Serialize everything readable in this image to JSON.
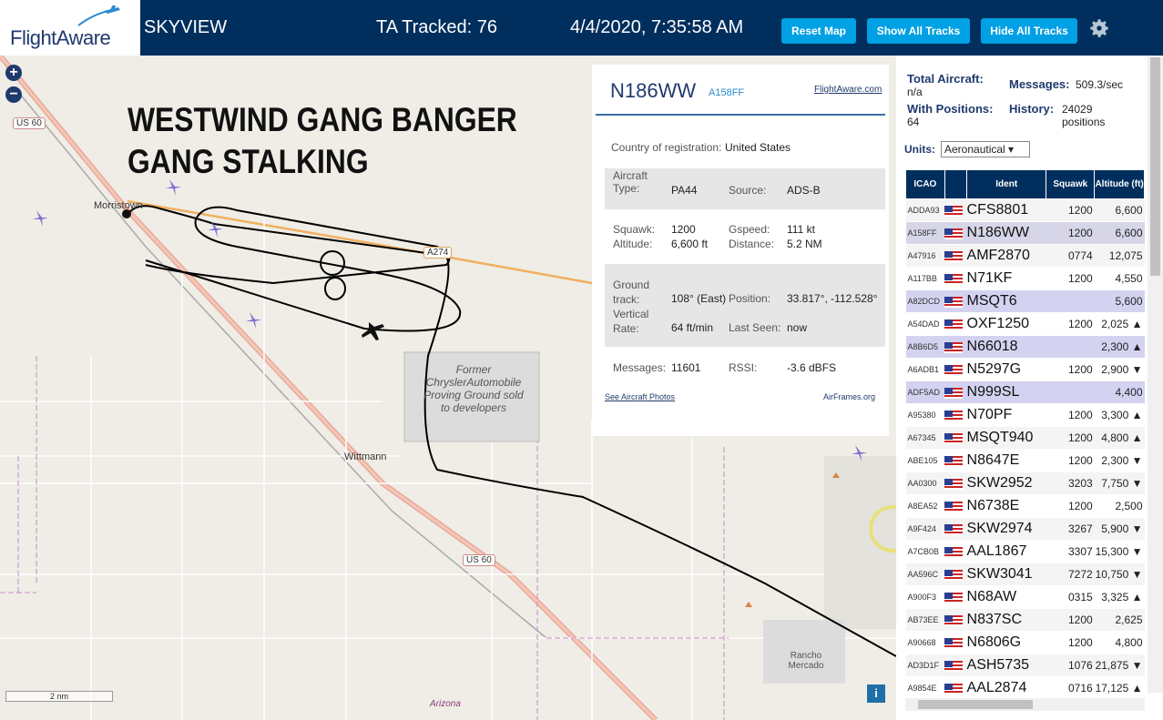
{
  "header": {
    "logo": "FlightAware",
    "app_title": "SKYVIEW",
    "tracked": "TA Tracked: 76",
    "datetime": "4/4/2020, 7:35:58 AM",
    "buttons": {
      "reset": "Reset Map",
      "show": "Show All Tracks",
      "hide": "Hide All Tracks"
    }
  },
  "map": {
    "overlay_line1": "WESTWIND GANG BANGER",
    "overlay_line2": "GANG STALKING",
    "labels": {
      "morristown": "Morristown",
      "wittmann": "Wittmann",
      "proving_ground": "Former ChryslerAutomobile Proving Ground sold to developers",
      "rancho": "Rancho Mercado",
      "arizona": "Arizona",
      "us60_top": "US 60",
      "us60_mid": "US 60",
      "a274": "A274"
    },
    "scale": "2 nm",
    "info": "i",
    "zoom_in": "+",
    "zoom_out": "−"
  },
  "detail": {
    "ident": "N186WW",
    "icao": "A158FF",
    "fa_link": "FlightAware.com",
    "country_label": "Country of registration:",
    "country": "United States",
    "aircraft_type_label": "Aircraft Type:",
    "aircraft_type": "PA44",
    "source_label": "Source:",
    "source": "ADS-B",
    "squawk_label": "Squawk:",
    "squawk": "1200",
    "gspeed_label": "Gspeed:",
    "gspeed": "111 kt",
    "altitude_label": "Altitude:",
    "altitude": "6,600 ft",
    "distance_label": "Distance:",
    "distance": "5.2 NM",
    "ground_track_label": "Ground track:",
    "ground_track": "108° (East)",
    "position_label": "Position:",
    "position": "33.817°, -112.528°",
    "vrate_label": "Vertical Rate:",
    "vrate": "64 ft/min",
    "last_seen_label": "Last Seen:",
    "last_seen": "now",
    "messages_label": "Messages:",
    "messages": "11601",
    "rssi_label": "RSSI:",
    "rssi": "-3.6 dBFS",
    "photos_link": "See Aircraft Photos",
    "airframes_link": "AirFrames.org"
  },
  "sidebar": {
    "total_label": "Total Aircraft:",
    "total": "n/a",
    "messages_label": "Messages:",
    "messages": "509.3/sec",
    "positions_label": "With Positions:",
    "positions": "64",
    "history_label": "History:",
    "history": "24029 positions",
    "units_label": "Units:",
    "units": "Aeronautical ▾",
    "columns": [
      "ICAO",
      "",
      "Ident",
      "Squawk",
      "Altitude (ft)"
    ],
    "rows": [
      {
        "icao": "ADDA93",
        "ident": "CFS8801",
        "squawk": "1200",
        "alt": "6,600"
      },
      {
        "icao": "A158FF",
        "ident": "N186WW",
        "squawk": "1200",
        "alt": "6,600"
      },
      {
        "icao": "A47916",
        "ident": "AMF2870",
        "squawk": "0774",
        "alt": "12,075"
      },
      {
        "icao": "A117BB",
        "ident": "N71KF",
        "squawk": "1200",
        "alt": "4,550"
      },
      {
        "icao": "A82DCD",
        "ident": "MSQT6",
        "squawk": "",
        "alt": "5,600"
      },
      {
        "icao": "A54DAD",
        "ident": "OXF1250",
        "squawk": "1200",
        "alt": "2,025 ▲"
      },
      {
        "icao": "A8B6D5",
        "ident": "N66018",
        "squawk": "",
        "alt": "2,300 ▲"
      },
      {
        "icao": "A6ADB1",
        "ident": "N5297G",
        "squawk": "1200",
        "alt": "2,900 ▼"
      },
      {
        "icao": "ADF5AD",
        "ident": "N999SL",
        "squawk": "",
        "alt": "4,400"
      },
      {
        "icao": "A95380",
        "ident": "N70PF",
        "squawk": "1200",
        "alt": "3,300 ▲"
      },
      {
        "icao": "A67345",
        "ident": "MSQT940",
        "squawk": "1200",
        "alt": "4,800 ▲"
      },
      {
        "icao": "ABE105",
        "ident": "N8647E",
        "squawk": "1200",
        "alt": "2,300 ▼"
      },
      {
        "icao": "AA0300",
        "ident": "SKW2952",
        "squawk": "3203",
        "alt": "7,750 ▼"
      },
      {
        "icao": "A8EA52",
        "ident": "N6738E",
        "squawk": "1200",
        "alt": "2,500"
      },
      {
        "icao": "A9F424",
        "ident": "SKW2974",
        "squawk": "3267",
        "alt": "5,900 ▼"
      },
      {
        "icao": "A7CB0B",
        "ident": "AAL1867",
        "squawk": "3307",
        "alt": "15,300 ▼"
      },
      {
        "icao": "AA596C",
        "ident": "SKW3041",
        "squawk": "7272",
        "alt": "10,750 ▼"
      },
      {
        "icao": "A900F3",
        "ident": "N68AW",
        "squawk": "0315",
        "alt": "3,325 ▲"
      },
      {
        "icao": "AB73EE",
        "ident": "N837SC",
        "squawk": "1200",
        "alt": "2,625"
      },
      {
        "icao": "A90668",
        "ident": "N6806G",
        "squawk": "1200",
        "alt": "4,800"
      },
      {
        "icao": "AD3D1F",
        "ident": "ASH5735",
        "squawk": "1076",
        "alt": "21,875 ▼"
      },
      {
        "icao": "A9854E",
        "ident": "AAL2874",
        "squawk": "0716",
        "alt": "17,125 ▲"
      }
    ]
  },
  "colors": {
    "header_bg": "#002f5d",
    "button": "#00a0e4",
    "accent": "#1f3a6d"
  }
}
